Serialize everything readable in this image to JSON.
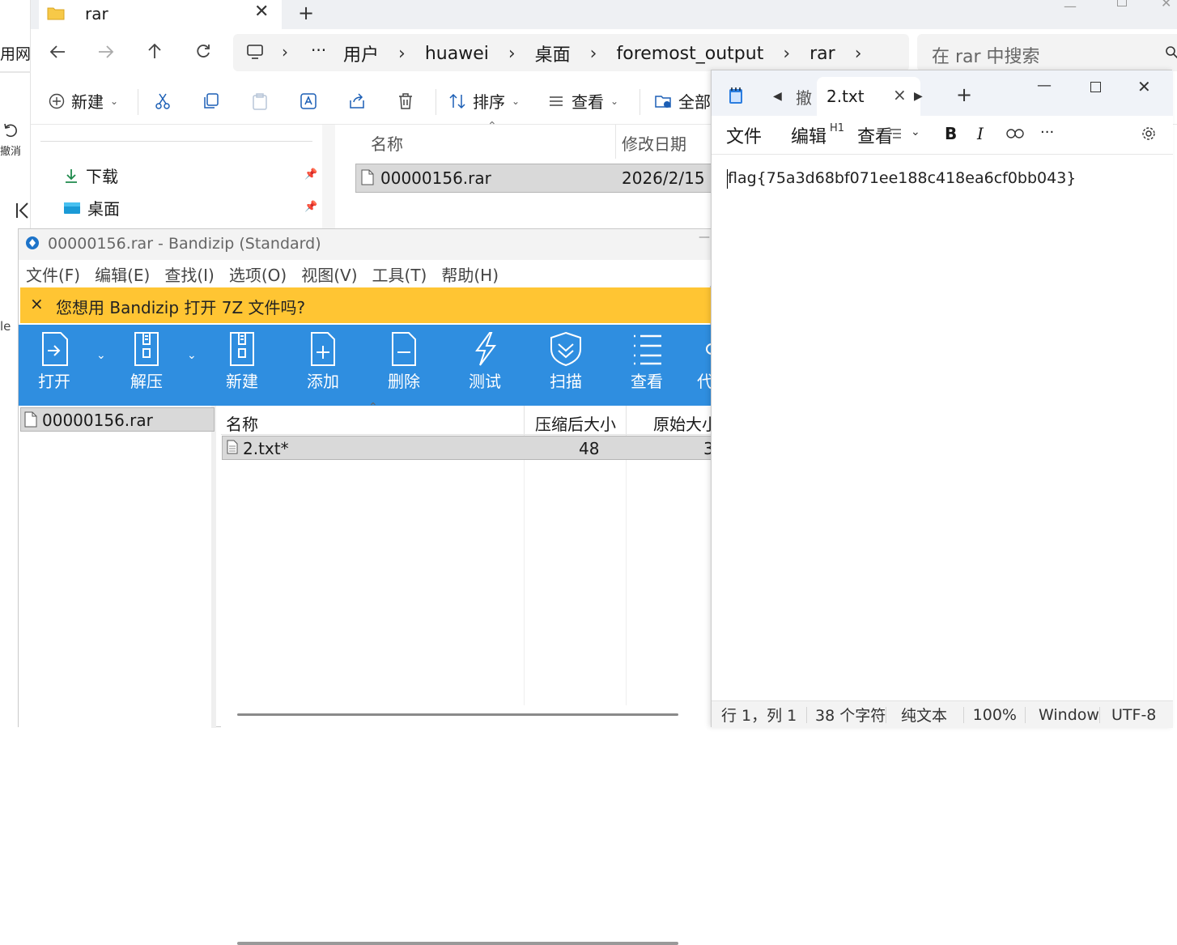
{
  "background_window": {
    "text_fragment": "用网北",
    "undo_label": "撤消",
    "side_letter": "le"
  },
  "explorer": {
    "tab_title": "rar",
    "new_tab": "+",
    "breadcrumb": [
      "用户",
      "huawei",
      "桌面",
      "foremost_output",
      "rar"
    ],
    "breadcrumb_more": "···",
    "search_placeholder": "在 rar 中搜索",
    "toolbar": {
      "new_label": "新建",
      "sort_label": "排序",
      "view_label": "查看",
      "select_all_label": "全部"
    },
    "quick_access": [
      {
        "label": "下载",
        "icon": "download-icon"
      },
      {
        "label": "桌面",
        "icon": "desktop-icon"
      }
    ],
    "columns": {
      "name": "名称",
      "modified": "修改日期"
    },
    "files": [
      {
        "name": "00000156.rar",
        "modified": "2026/2/15"
      }
    ]
  },
  "bandizip": {
    "title": "00000156.rar - Bandizip (Standard)",
    "menu": [
      "文件(F)",
      "编辑(E)",
      "查找(I)",
      "选项(O)",
      "视图(V)",
      "工具(T)",
      "帮助(H)"
    ],
    "banner_text": "您想用 Bandizip 打开 7Z 文件吗?",
    "banner_close": "×",
    "tools": [
      {
        "label": "打开",
        "icon": "open-icon"
      },
      {
        "label": "解压",
        "icon": "extract-icon"
      },
      {
        "label": "新建",
        "icon": "new-archive-icon"
      },
      {
        "label": "添加",
        "icon": "add-file-icon"
      },
      {
        "label": "删除",
        "icon": "delete-file-icon"
      },
      {
        "label": "测试",
        "icon": "test-icon"
      },
      {
        "label": "扫描",
        "icon": "scan-shield-icon"
      },
      {
        "label": "查看",
        "icon": "view-list-icon"
      },
      {
        "label": "代",
        "icon": "more-icon"
      }
    ],
    "tree": [
      {
        "name": "00000156.rar"
      }
    ],
    "columns": {
      "name": "名称",
      "compressed": "压缩后大小",
      "original": "原始大小"
    },
    "entries": [
      {
        "name": "2.txt*",
        "compressed": "48",
        "original": "3"
      }
    ]
  },
  "notepad": {
    "prev_tab_fragment": "撤",
    "tab_title": "2.txt",
    "tab_close": "×",
    "new_tab": "+",
    "menu": {
      "file": "文件",
      "edit": "编辑",
      "view": "查看"
    },
    "heading_marker": "H1",
    "format": {
      "bold": "B",
      "italic": "I",
      "more": "···"
    },
    "content": "flag{75a3d68bf071ee188c418ea6cf0bb043}",
    "status": {
      "position": "行 1，列 1",
      "chars": "38 个字符",
      "format": "纯文本",
      "zoom": "100%",
      "line_ending": "Windows (CRLF)",
      "encoding": "UTF-8"
    }
  }
}
